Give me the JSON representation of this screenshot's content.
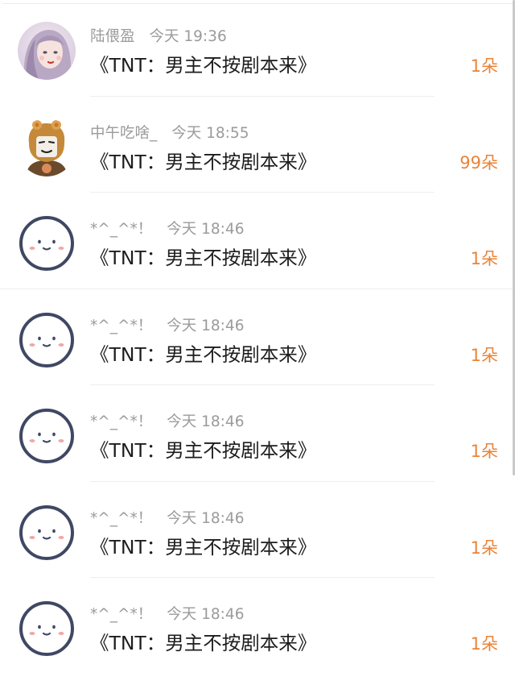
{
  "messages": [
    {
      "sender": "陆偎盈",
      "time": "今天 19:36",
      "title": "《TNT：男主不按剧本来》",
      "gift": "1朵",
      "avatar_icon": "girl-portrait-avatar"
    },
    {
      "sender": "中午吃啥_",
      "time": "今天 18:55",
      "title": "《TNT：男主不按剧本来》",
      "gift": "99朵",
      "avatar_icon": "meme-face-avatar"
    },
    {
      "sender": "*^_^*！",
      "time": "今天 18:46",
      "title": "《TNT：男主不按剧本来》",
      "gift": "1朵",
      "avatar_icon": "smiley-face-avatar"
    },
    {
      "sender": "*^_^*！",
      "time": "今天 18:46",
      "title": "《TNT：男主不按剧本来》",
      "gift": "1朵",
      "avatar_icon": "smiley-face-avatar"
    },
    {
      "sender": "*^_^*！",
      "time": "今天 18:46",
      "title": "《TNT：男主不按剧本来》",
      "gift": "1朵",
      "avatar_icon": "smiley-face-avatar"
    },
    {
      "sender": "*^_^*！",
      "time": "今天 18:46",
      "title": "《TNT：男主不按剧本来》",
      "gift": "1朵",
      "avatar_icon": "smiley-face-avatar"
    },
    {
      "sender": "*^_^*！",
      "time": "今天 18:46",
      "title": "《TNT：男主不按剧本来》",
      "gift": "1朵",
      "avatar_icon": "smiley-face-avatar"
    }
  ],
  "colors": {
    "gift_accent": "#e8843a",
    "meta_text": "#9b9b9b",
    "title_text": "#1d1d1d",
    "avatar_outline": "#3f4863",
    "avatar_blush": "#f2a7a7"
  }
}
